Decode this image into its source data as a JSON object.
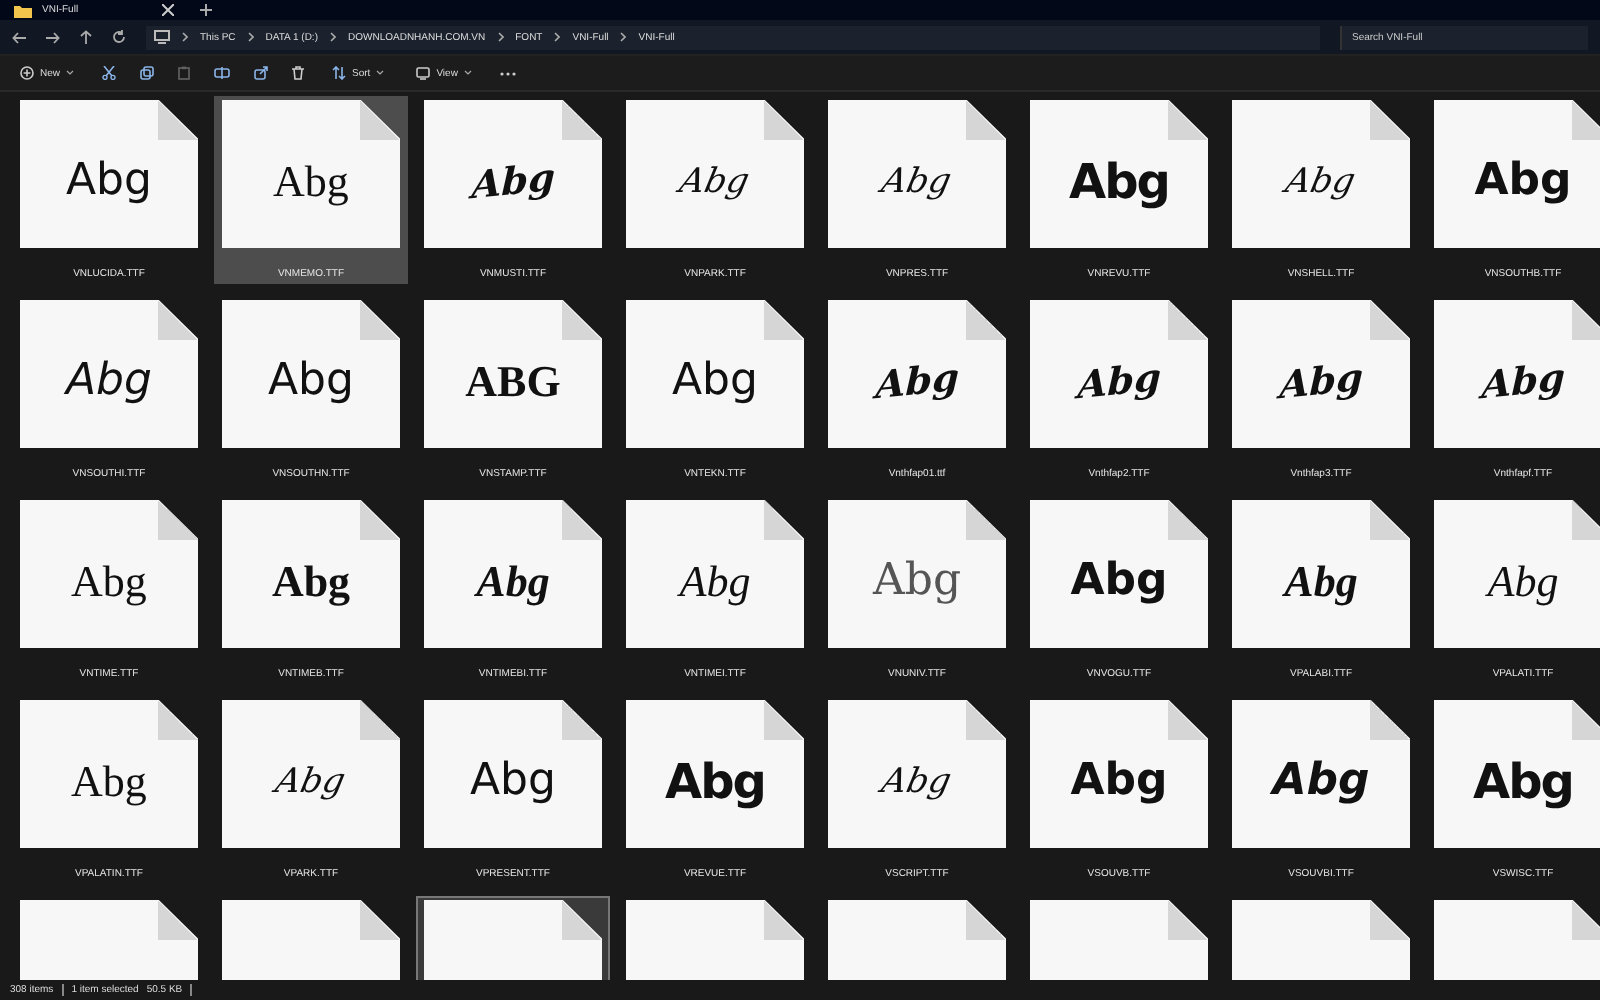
{
  "tab": {
    "title": "VNI-Full"
  },
  "breadcrumbs": [
    "This PC",
    "DATA 1 (D:)",
    "DOWNLOADNHANH.COM.VN",
    "FONT",
    "VNI-Full",
    "VNI-Full"
  ],
  "search": {
    "placeholder": "Search VNI-Full"
  },
  "toolbar": [
    {
      "kind": "new",
      "label": "New",
      "disabled": false
    },
    {
      "kind": "cut",
      "disabled": false
    },
    {
      "kind": "copy",
      "disabled": false
    },
    {
      "kind": "paste",
      "disabled": true
    },
    {
      "kind": "rename",
      "disabled": false
    },
    {
      "kind": "share",
      "disabled": false
    },
    {
      "kind": "delete",
      "disabled": false
    },
    {
      "kind": "sort",
      "label": "Sort",
      "disabled": false
    },
    {
      "kind": "view",
      "label": "View",
      "disabled": false
    },
    {
      "kind": "more",
      "disabled": false
    }
  ],
  "files": [
    {
      "name": "VNLUCIDA.TTF",
      "sample": "Abg",
      "kind": "sans",
      "selected": false,
      "hovered": false
    },
    {
      "name": "VNMEMO.TTF",
      "sample": "Abg",
      "kind": "serif",
      "selected": true,
      "hovered": false
    },
    {
      "name": "VNMUSTI.TTF",
      "sample": "Abg",
      "kind": "brush",
      "selected": false,
      "hovered": false
    },
    {
      "name": "VNPARK.TTF",
      "sample": "Abg",
      "kind": "script",
      "selected": false,
      "hovered": false
    },
    {
      "name": "VNPRES.TTF",
      "sample": "Abg",
      "kind": "script",
      "selected": false,
      "hovered": false
    },
    {
      "name": "VNREVU.TTF",
      "sample": "Abg",
      "kind": "heavy",
      "selected": false,
      "hovered": false
    },
    {
      "name": "VNSHELL.TTF",
      "sample": "Abg",
      "kind": "script",
      "selected": false,
      "hovered": false
    },
    {
      "name": "VNSOUTHB.TTF",
      "sample": "Abg",
      "kind": "bold",
      "selected": false,
      "hovered": false
    },
    {
      "name": "VNSOUTHI.TTF",
      "sample": "Abg",
      "kind": "oblique",
      "selected": false,
      "hovered": false
    },
    {
      "name": "VNSOUTHN.TTF",
      "sample": "Abg",
      "kind": "sans",
      "selected": false,
      "hovered": false
    },
    {
      "name": "VNSTAMP.TTF",
      "sample": "ABG",
      "kind": "slab",
      "selected": false,
      "hovered": false
    },
    {
      "name": "VNTEKN.TTF",
      "sample": "Abg",
      "kind": "sans",
      "selected": false,
      "hovered": false
    },
    {
      "name": "Vnthfap01.ttf",
      "sample": "Abg",
      "kind": "brush",
      "selected": false,
      "hovered": false
    },
    {
      "name": "Vnthfap2.TTF",
      "sample": "Abg",
      "kind": "brush",
      "selected": false,
      "hovered": false
    },
    {
      "name": "Vnthfap3.TTF",
      "sample": "Abg",
      "kind": "brush",
      "selected": false,
      "hovered": false
    },
    {
      "name": "Vnthfapf.TTF",
      "sample": "Abg",
      "kind": "brush",
      "selected": false,
      "hovered": false
    },
    {
      "name": "VNTIME.TTF",
      "sample": "Abg",
      "kind": "serif",
      "selected": false,
      "hovered": false
    },
    {
      "name": "VNTIMEB.TTF",
      "sample": "Abg",
      "kind": "slab",
      "selected": false,
      "hovered": false
    },
    {
      "name": "VNTIMEBI.TTF",
      "sample": "Abg",
      "kind": "bolditalic",
      "selected": false,
      "hovered": false
    },
    {
      "name": "VNTIMEI.TTF",
      "sample": "Abg",
      "kind": "italic",
      "selected": false,
      "hovered": false
    },
    {
      "name": "VNUNIV.TTF",
      "sample": "Abg",
      "kind": "light",
      "selected": false,
      "hovered": false
    },
    {
      "name": "VNVOGU.TTF",
      "sample": "Abg",
      "kind": "bold",
      "selected": false,
      "hovered": false
    },
    {
      "name": "VPALABI.TTF",
      "sample": "Abg",
      "kind": "bolditalic",
      "selected": false,
      "hovered": false
    },
    {
      "name": "VPALATI.TTF",
      "sample": "Abg",
      "kind": "italic",
      "selected": false,
      "hovered": false
    },
    {
      "name": "VPALATIN.TTF",
      "sample": "Abg",
      "kind": "serif",
      "selected": false,
      "hovered": false
    },
    {
      "name": "VPARK.TTF",
      "sample": "Abg",
      "kind": "script",
      "selected": false,
      "hovered": false
    },
    {
      "name": "VPRESENT.TTF",
      "sample": "Abg",
      "kind": "sans",
      "selected": false,
      "hovered": false
    },
    {
      "name": "VREVUE.TTF",
      "sample": "Abg",
      "kind": "heavy",
      "selected": false,
      "hovered": false
    },
    {
      "name": "VSCRIPT.TTF",
      "sample": "Abg",
      "kind": "script",
      "selected": false,
      "hovered": false
    },
    {
      "name": "VSOUVB.TTF",
      "sample": "Abg",
      "kind": "bold",
      "selected": false,
      "hovered": false
    },
    {
      "name": "VSOUVBI.TTF",
      "sample": "Abg",
      "kind": "boldoblique",
      "selected": false,
      "hovered": false
    },
    {
      "name": "VSWISC.TTF",
      "sample": "Abg",
      "kind": "heavy",
      "selected": false,
      "hovered": false
    },
    {
      "selected": false,
      "hovered": false
    },
    {
      "selected": false,
      "hovered": false
    },
    {
      "selected": false,
      "hovered": true
    },
    {
      "selected": false,
      "hovered": false
    },
    {
      "selected": false,
      "hovered": false
    },
    {
      "selected": false,
      "hovered": false
    },
    {
      "selected": false,
      "hovered": false
    },
    {
      "selected": false,
      "hovered": false
    }
  ],
  "status_bar": {
    "item_count": "308 items",
    "selection": "1 item selected",
    "size": "50.5 KB"
  }
}
